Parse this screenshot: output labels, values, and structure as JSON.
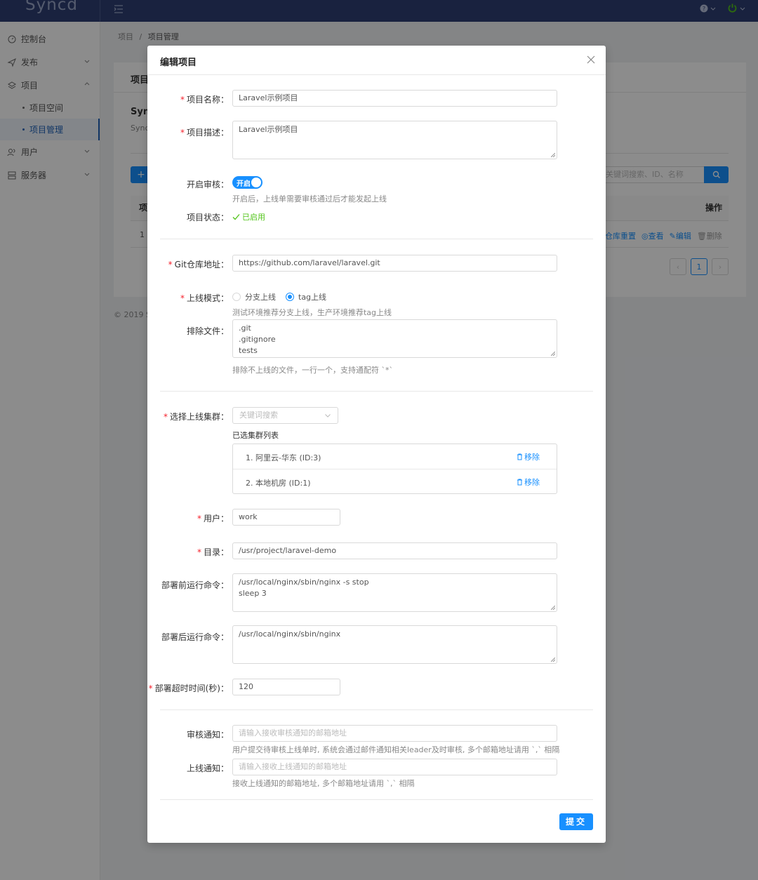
{
  "app": {
    "logo": "Syncd"
  },
  "sidebar": {
    "items": [
      {
        "label": "控制台"
      },
      {
        "label": "发布"
      },
      {
        "label": "项目"
      },
      {
        "label": "项目空间"
      },
      {
        "label": "项目管理"
      },
      {
        "label": "用户"
      },
      {
        "label": "服务器"
      }
    ]
  },
  "breadcrumb": {
    "parent": "项目",
    "sep": "/",
    "current": "项目管理"
  },
  "background": {
    "card_title": "项目",
    "heading": "Sync",
    "subheading": "Sync",
    "add_button": "+",
    "search_placeholder": "关键词搜索、ID、名称",
    "table_headers": {
      "first": "项",
      "actions": "操作"
    },
    "row_index": "1",
    "row_actions": {
      "reset": "仓库重置",
      "view": "查看",
      "edit": "编辑",
      "delete": "删除"
    },
    "pager": {
      "current": "1"
    },
    "footer": "© 2019 S"
  },
  "modal": {
    "title": "编辑项目",
    "fields": {
      "name": {
        "label": "项目名称：",
        "value": "Laravel示例项目"
      },
      "desc": {
        "label": "项目描述：",
        "value": "Laravel示例项目"
      },
      "audit": {
        "label": "开启审核：",
        "switch_text": "开启",
        "hint": "开启后，上线单需要审核通过后才能发起上线"
      },
      "status": {
        "label": "项目状态：",
        "value": "已启用"
      },
      "repo": {
        "label": "Git仓库地址：",
        "value": "https://github.com/laravel/laravel.git"
      },
      "mode": {
        "label": "上线模式：",
        "option_branch": "分支上线",
        "option_tag": "tag上线",
        "hint": "测试环境推荐分支上线，生产环境推荐tag上线"
      },
      "exclude": {
        "label": "排除文件：",
        "value": ".git\n.gitignore\ntests",
        "hint": "排除不上线的文件，一行一个，支持通配符 `*`"
      },
      "cluster": {
        "label": "选择上线集群：",
        "placeholder": "关键词搜索",
        "list_title": "已选集群列表",
        "items": [
          "1. 阿里云-华东 (ID:3)",
          "2. 本地机房 (ID:1)"
        ],
        "remove_label": "移除"
      },
      "user": {
        "label": "用户：",
        "value": "work"
      },
      "dir": {
        "label": "目录：",
        "value": "/usr/project/laravel-demo"
      },
      "pre_cmd": {
        "label": "部署前运行命令：",
        "value": "/usr/local/nginx/sbin/nginx -s stop\nsleep 3"
      },
      "post_cmd": {
        "label": "部署后运行命令：",
        "value": "/usr/local/nginx/sbin/nginx"
      },
      "timeout": {
        "label": "部署超时时间(秒)：",
        "value": "120"
      },
      "audit_notice": {
        "label": "审核通知：",
        "placeholder": "请输入接收审核通知的邮箱地址",
        "hint": "用户提交待审核上线单时, 系统会通过邮件通知相关leader及时审核, 多个邮箱地址请用 `,` 相隔"
      },
      "deploy_notice": {
        "label": "上线通知：",
        "placeholder": "请输入接收上线通知的邮箱地址",
        "hint": "接收上线通知的邮箱地址, 多个邮箱地址请用 `,` 相隔"
      }
    },
    "required_mark": "*",
    "submit": "提交"
  },
  "colors": {
    "primary": "#1890ff",
    "topbar": "#2f3f73",
    "success": "#52c41a",
    "required": "#f5222d"
  }
}
